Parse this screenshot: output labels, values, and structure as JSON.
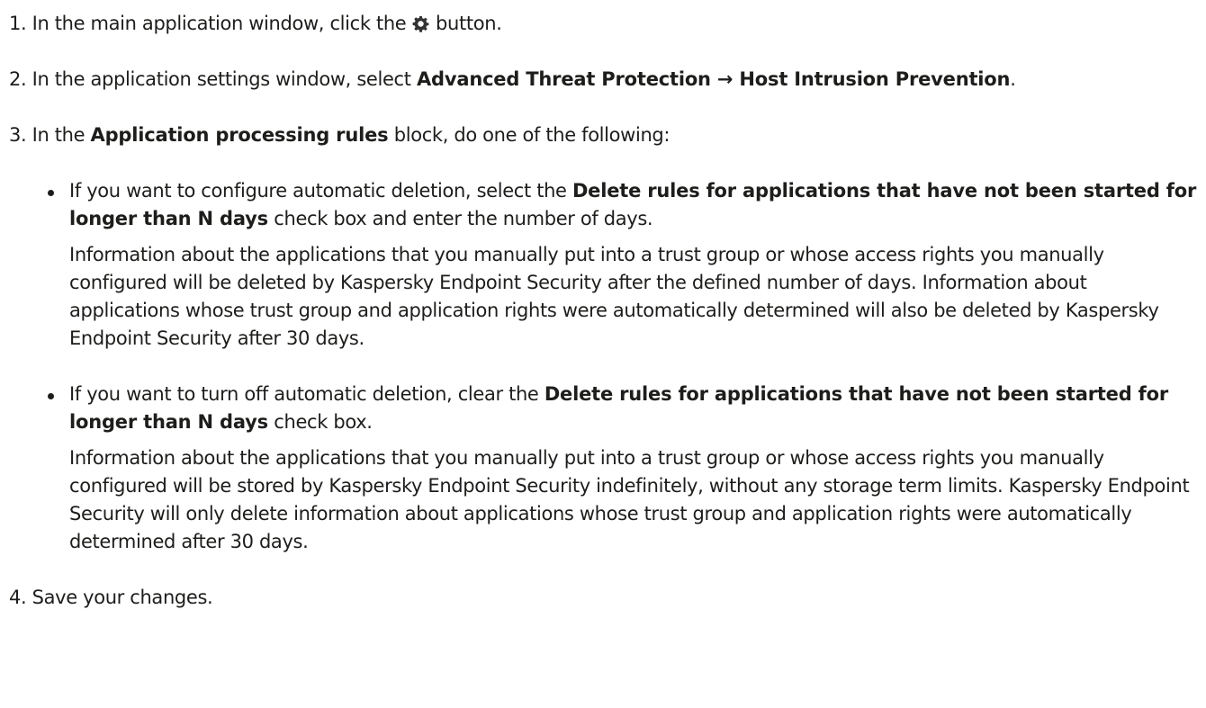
{
  "steps": [
    {
      "pre": "1. In the main application window, click the ",
      "icon": "gear-icon",
      "post": " button."
    },
    {
      "pre": "2. In the application settings window, select ",
      "bold": "Advanced Threat Protection → Host Intrusion Prevention",
      "post": "."
    },
    {
      "pre": "3. In the ",
      "bold": "Application processing rules",
      "post": " block, do one of the following:"
    },
    {
      "text": "4. Save your changes."
    }
  ],
  "options": [
    {
      "pre": "If you want to configure automatic deletion, select the ",
      "bold": "Delete rules for applications that have not been started for longer than N days",
      "post": " check box and enter the number of days.",
      "note": "Information about the applications that you manually put into a trust group or whose access rights you manually configured will be deleted by Kaspersky Endpoint Security after the defined number of days. Information about applications whose trust group and application rights were automatically determined will also be deleted by Kaspersky Endpoint Security after 30 days."
    },
    {
      "pre": "If you want to turn off automatic deletion, clear the ",
      "bold": "Delete rules for applications that have not been started for longer than N days",
      "post": " check box.",
      "note": "Information about the applications that you manually put into a trust group or whose access rights you manually configured will be stored by Kaspersky Endpoint Security indefinitely, without any storage term limits. Kaspersky Endpoint Security will only delete information about applications whose trust group and application rights were automatically determined after 30 days."
    }
  ]
}
